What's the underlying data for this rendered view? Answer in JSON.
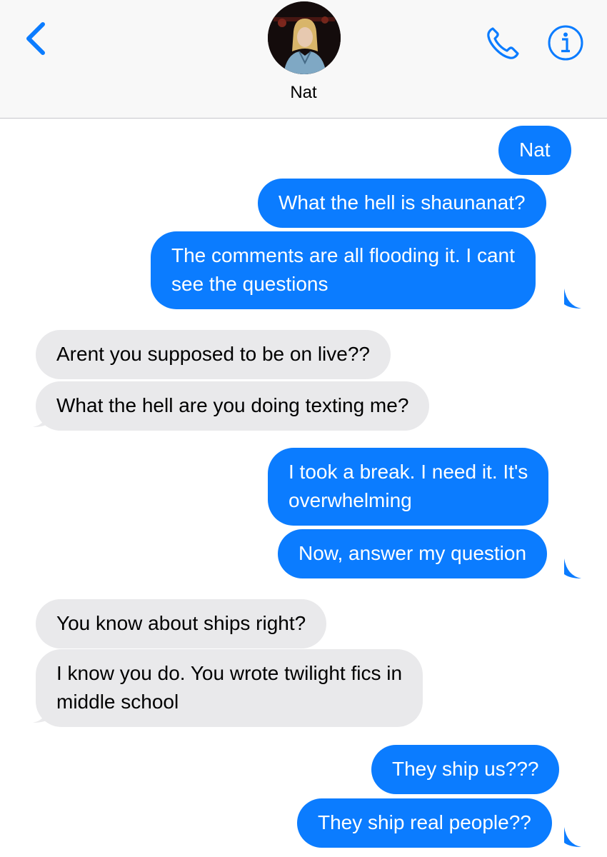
{
  "header": {
    "contact_name": "Nat",
    "back_icon": "chevron-left-icon",
    "call_icon": "phone-icon",
    "info_icon": "info-icon",
    "accent_color": "#0b7cff"
  },
  "messages": [
    {
      "from": "me",
      "lines": [
        "Nat"
      ]
    },
    {
      "from": "me",
      "lines": [
        "What the hell is shaunanat?"
      ]
    },
    {
      "from": "me",
      "lines": [
        "The comments are all flooding it. I cant",
        "see the questions"
      ]
    },
    {
      "from": "them",
      "lines": [
        "Arent you supposed to be on live??"
      ]
    },
    {
      "from": "them",
      "lines": [
        "What the hell are you doing texting me?"
      ]
    },
    {
      "from": "me",
      "lines": [
        "I took a break. I need it. It's",
        "overwhelming"
      ]
    },
    {
      "from": "me",
      "lines": [
        "Now, answer my question"
      ]
    },
    {
      "from": "them",
      "lines": [
        "You know about ships right?"
      ]
    },
    {
      "from": "them",
      "lines": [
        "I know you do. You wrote twilight fics in",
        "middle school"
      ]
    },
    {
      "from": "me",
      "lines": [
        "They ship us???"
      ]
    },
    {
      "from": "me",
      "lines": [
        "They ship real people??"
      ]
    }
  ],
  "colors": {
    "sent_bubble": "#0b7cff",
    "received_bubble": "#e9e9eb"
  }
}
